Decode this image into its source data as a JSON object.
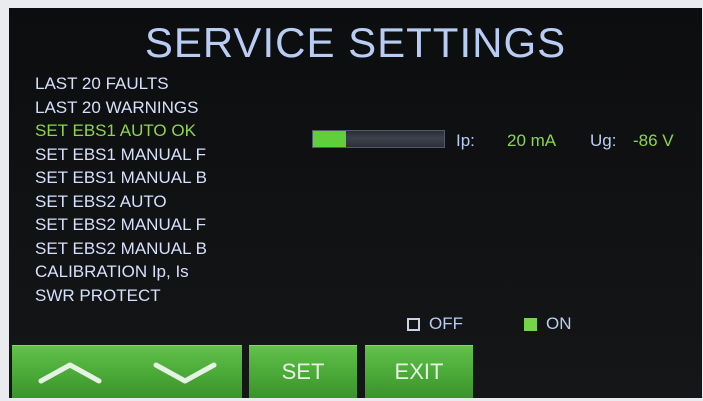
{
  "title": "SERVICE SETTINGS",
  "menu": [
    {
      "label": "LAST 20 FAULTS",
      "active": false
    },
    {
      "label": "LAST 20 WARNINGS",
      "active": false
    },
    {
      "label": "SET EBS1 AUTO OK",
      "active": true
    },
    {
      "label": "SET EBS1 MANUAL F",
      "active": false
    },
    {
      "label": "SET EBS1 MANUAL B",
      "active": false
    },
    {
      "label": "SET EBS2 AUTO",
      "active": false
    },
    {
      "label": "SET EBS2 MANUAL F",
      "active": false
    },
    {
      "label": "SET EBS2 MANUAL B",
      "active": false
    },
    {
      "label": "CALIBRATION Ip, Is",
      "active": false
    },
    {
      "label": "SWR PROTECT",
      "active": false
    }
  ],
  "status": {
    "level_fraction": 0.25,
    "ip_label": "Ip:",
    "ip_value": "20 mA",
    "ug_label": "Ug:",
    "ug_value": "-86 V"
  },
  "swr": {
    "off_label": "OFF",
    "off_checked": false,
    "on_label": "ON",
    "on_checked": true
  },
  "buttons": {
    "up_icon": "chevron-up-icon",
    "down_icon": "chevron-down-icon",
    "set_label": "SET",
    "exit_label": "EXIT"
  },
  "colors": {
    "title": "#b9cdf4",
    "menu_text": "#d6e0fb",
    "active_text": "#8ed54a",
    "button_green": "#4aa937",
    "bar_fill": "#5fcf3a"
  }
}
